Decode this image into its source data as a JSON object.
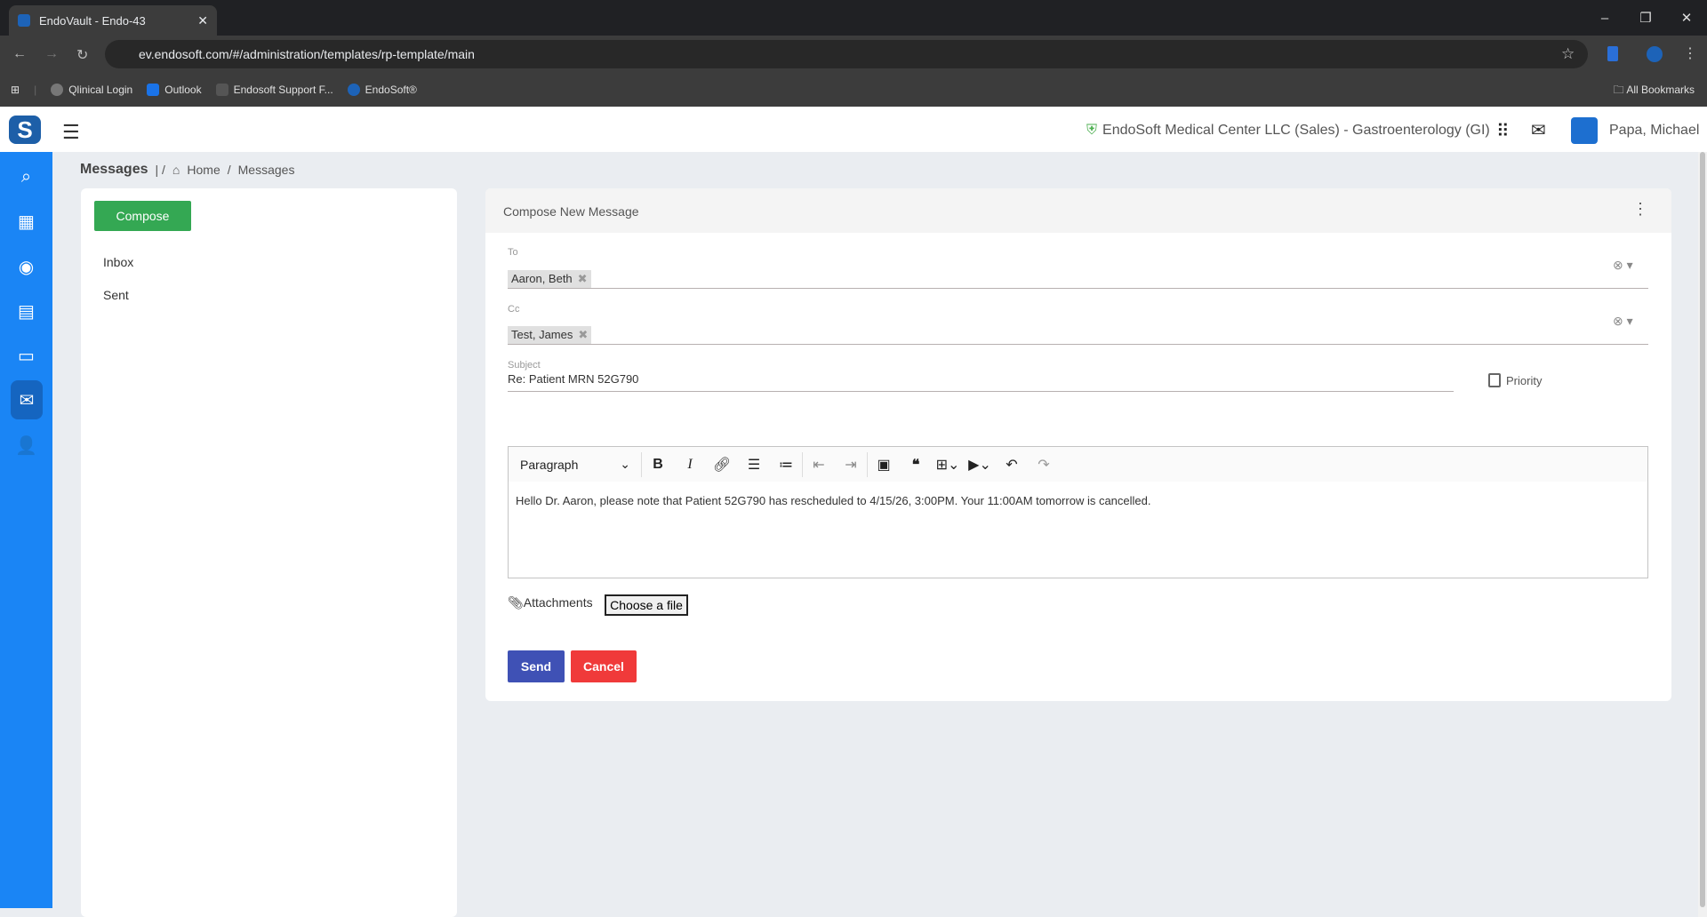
{
  "browser": {
    "tab_title": "EndoVault - Endo-43",
    "url": "ev.endosoft.com/#/administration/templates/rp-template/main",
    "bookmarks": [
      "Qlinical Login",
      "Outlook",
      "Endosoft Support F...",
      "EndoSoft®"
    ],
    "all_bookmarks": "All Bookmarks"
  },
  "header": {
    "org": "EndoSoft Medical Center LLC (Sales) - Gastroenterology (GI)",
    "user": "Papa, Michael"
  },
  "breadcrumb": {
    "title": "Messages",
    "home": "Home",
    "current": "Messages"
  },
  "left": {
    "compose": "Compose",
    "folders": [
      "Inbox",
      "Sent"
    ]
  },
  "compose": {
    "title": "Compose New Message",
    "to_label": "To",
    "to": [
      "Aaron, Beth"
    ],
    "cc_label": "Cc",
    "cc": [
      "Test, James"
    ],
    "subject_label": "Subject",
    "subject": "Re: Patient MRN 52G790",
    "priority": "Priority",
    "priority_checked": false,
    "format": "Paragraph",
    "body": "Hello Dr. Aaron, please note that Patient 52G790 has rescheduled to 4/15/26, 3:00PM. Your 11:00AM tomorrow is cancelled.",
    "attachments": "Attachments",
    "choose_file": "Choose a file",
    "send": "Send",
    "cancel": "Cancel"
  },
  "colors": {
    "sidebar": "#1a85f5",
    "send": "#3f51b5",
    "cancel": "#f03a3a",
    "compose": "#34a853"
  }
}
